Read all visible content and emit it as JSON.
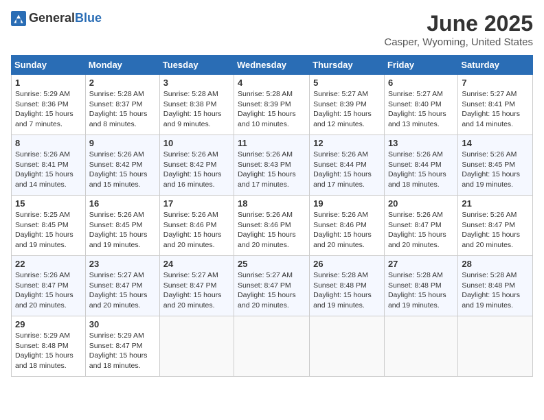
{
  "header": {
    "logo_general": "General",
    "logo_blue": "Blue",
    "month_title": "June 2025",
    "location": "Casper, Wyoming, United States"
  },
  "calendar": {
    "days_of_week": [
      "Sunday",
      "Monday",
      "Tuesday",
      "Wednesday",
      "Thursday",
      "Friday",
      "Saturday"
    ],
    "weeks": [
      [
        {
          "num": "",
          "info": ""
        },
        {
          "num": "2",
          "info": "Sunrise: 5:28 AM\nSunset: 8:37 PM\nDaylight: 15 hours\nand 8 minutes."
        },
        {
          "num": "3",
          "info": "Sunrise: 5:28 AM\nSunset: 8:38 PM\nDaylight: 15 hours\nand 9 minutes."
        },
        {
          "num": "4",
          "info": "Sunrise: 5:28 AM\nSunset: 8:39 PM\nDaylight: 15 hours\nand 10 minutes."
        },
        {
          "num": "5",
          "info": "Sunrise: 5:27 AM\nSunset: 8:39 PM\nDaylight: 15 hours\nand 12 minutes."
        },
        {
          "num": "6",
          "info": "Sunrise: 5:27 AM\nSunset: 8:40 PM\nDaylight: 15 hours\nand 13 minutes."
        },
        {
          "num": "7",
          "info": "Sunrise: 5:27 AM\nSunset: 8:41 PM\nDaylight: 15 hours\nand 14 minutes."
        }
      ],
      [
        {
          "num": "1",
          "info": "Sunrise: 5:29 AM\nSunset: 8:36 PM\nDaylight: 15 hours\nand 7 minutes."
        },
        {
          "num": "9",
          "info": "Sunrise: 5:26 AM\nSunset: 8:42 PM\nDaylight: 15 hours\nand 15 minutes."
        },
        {
          "num": "10",
          "info": "Sunrise: 5:26 AM\nSunset: 8:42 PM\nDaylight: 15 hours\nand 16 minutes."
        },
        {
          "num": "11",
          "info": "Sunrise: 5:26 AM\nSunset: 8:43 PM\nDaylight: 15 hours\nand 17 minutes."
        },
        {
          "num": "12",
          "info": "Sunrise: 5:26 AM\nSunset: 8:44 PM\nDaylight: 15 hours\nand 17 minutes."
        },
        {
          "num": "13",
          "info": "Sunrise: 5:26 AM\nSunset: 8:44 PM\nDaylight: 15 hours\nand 18 minutes."
        },
        {
          "num": "14",
          "info": "Sunrise: 5:26 AM\nSunset: 8:45 PM\nDaylight: 15 hours\nand 19 minutes."
        }
      ],
      [
        {
          "num": "8",
          "info": "Sunrise: 5:26 AM\nSunset: 8:41 PM\nDaylight: 15 hours\nand 14 minutes."
        },
        {
          "num": "16",
          "info": "Sunrise: 5:26 AM\nSunset: 8:45 PM\nDaylight: 15 hours\nand 19 minutes."
        },
        {
          "num": "17",
          "info": "Sunrise: 5:26 AM\nSunset: 8:46 PM\nDaylight: 15 hours\nand 20 minutes."
        },
        {
          "num": "18",
          "info": "Sunrise: 5:26 AM\nSunset: 8:46 PM\nDaylight: 15 hours\nand 20 minutes."
        },
        {
          "num": "19",
          "info": "Sunrise: 5:26 AM\nSunset: 8:46 PM\nDaylight: 15 hours\nand 20 minutes."
        },
        {
          "num": "20",
          "info": "Sunrise: 5:26 AM\nSunset: 8:47 PM\nDaylight: 15 hours\nand 20 minutes."
        },
        {
          "num": "21",
          "info": "Sunrise: 5:26 AM\nSunset: 8:47 PM\nDaylight: 15 hours\nand 20 minutes."
        }
      ],
      [
        {
          "num": "15",
          "info": "Sunrise: 5:25 AM\nSunset: 8:45 PM\nDaylight: 15 hours\nand 19 minutes."
        },
        {
          "num": "23",
          "info": "Sunrise: 5:27 AM\nSunset: 8:47 PM\nDaylight: 15 hours\nand 20 minutes."
        },
        {
          "num": "24",
          "info": "Sunrise: 5:27 AM\nSunset: 8:47 PM\nDaylight: 15 hours\nand 20 minutes."
        },
        {
          "num": "25",
          "info": "Sunrise: 5:27 AM\nSunset: 8:47 PM\nDaylight: 15 hours\nand 20 minutes."
        },
        {
          "num": "26",
          "info": "Sunrise: 5:28 AM\nSunset: 8:48 PM\nDaylight: 15 hours\nand 19 minutes."
        },
        {
          "num": "27",
          "info": "Sunrise: 5:28 AM\nSunset: 8:48 PM\nDaylight: 15 hours\nand 19 minutes."
        },
        {
          "num": "28",
          "info": "Sunrise: 5:28 AM\nSunset: 8:48 PM\nDaylight: 15 hours\nand 19 minutes."
        }
      ],
      [
        {
          "num": "22",
          "info": "Sunrise: 5:26 AM\nSunset: 8:47 PM\nDaylight: 15 hours\nand 20 minutes."
        },
        {
          "num": "30",
          "info": "Sunrise: 5:29 AM\nSunset: 8:47 PM\nDaylight: 15 hours\nand 18 minutes."
        },
        {
          "num": "",
          "info": ""
        },
        {
          "num": "",
          "info": ""
        },
        {
          "num": "",
          "info": ""
        },
        {
          "num": "",
          "info": ""
        },
        {
          "num": "",
          "info": ""
        }
      ],
      [
        {
          "num": "29",
          "info": "Sunrise: 5:29 AM\nSunset: 8:48 PM\nDaylight: 15 hours\nand 18 minutes."
        },
        {
          "num": "",
          "info": ""
        },
        {
          "num": "",
          "info": ""
        },
        {
          "num": "",
          "info": ""
        },
        {
          "num": "",
          "info": ""
        },
        {
          "num": "",
          "info": ""
        },
        {
          "num": "",
          "info": ""
        }
      ]
    ]
  }
}
